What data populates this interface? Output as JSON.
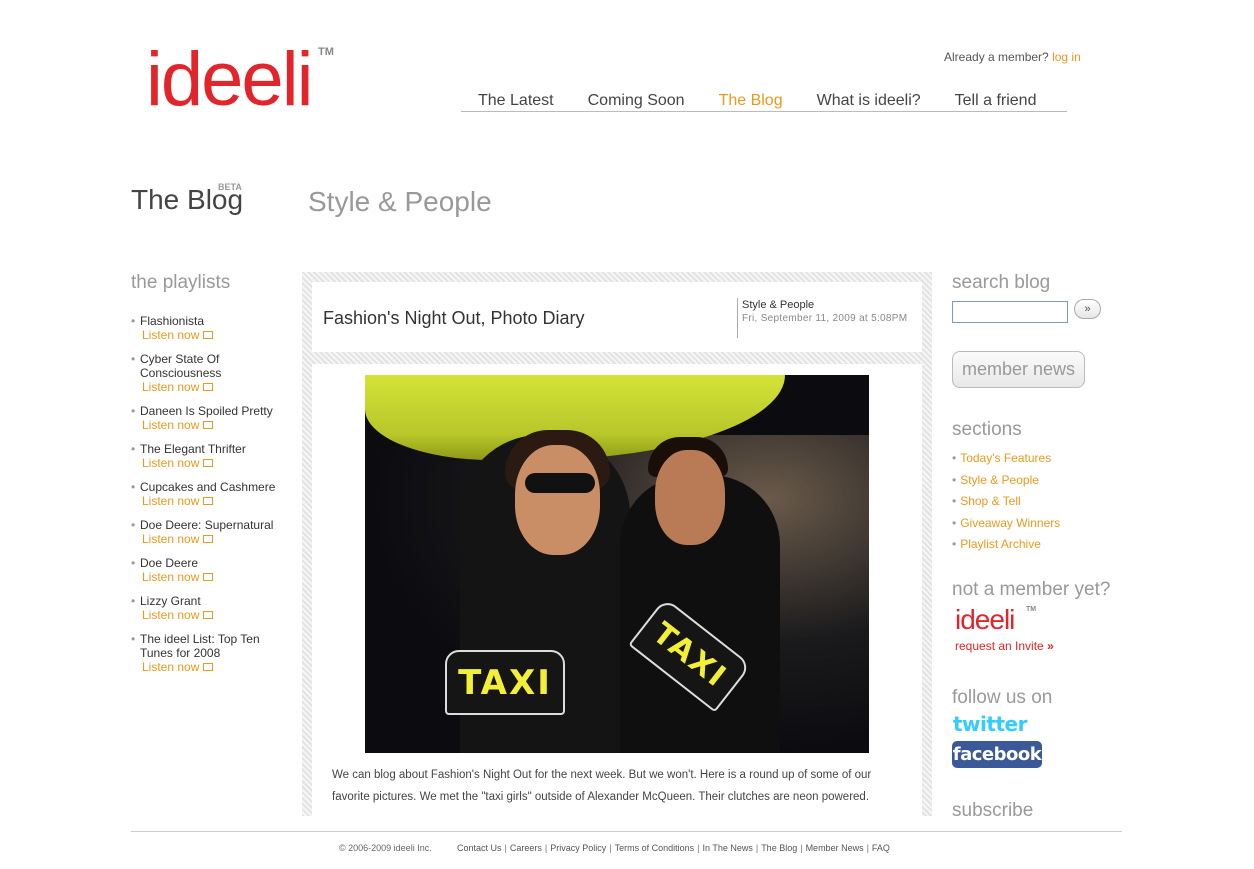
{
  "header": {
    "logo": "ideeli",
    "logo_tm": "TM",
    "member_text": "Already a member?",
    "login_label": "log in",
    "nav": [
      "The Latest",
      "Coming Soon",
      "The Blog",
      "What is ideeli?",
      "Tell a friend"
    ],
    "nav_active_index": 2
  },
  "blog": {
    "title": "The Blog",
    "beta": "BETA",
    "section": "Style & People"
  },
  "playlists": {
    "heading": "the playlists",
    "listen_label": "Listen now",
    "items": [
      "Flashionista",
      "Cyber State Of Consciousness",
      "Daneen Is Spoiled Pretty",
      "The Elegant Thrifter",
      "Cupcakes and Cashmere",
      "Doe Deere: Supernatural",
      "Doe Deere",
      "Lizzy Grant",
      "The ideel List: Top Ten Tunes for 2008"
    ]
  },
  "post": {
    "title": "Fashion's Night Out, Photo Diary",
    "category": "Style & People",
    "date": "Fri, September 11, 2009 at 5:08PM",
    "taxi_text": "TAXI",
    "body": "We can blog about Fashion's Night Out for the next week. But we won't. Here is a round up of some of our favorite pictures. We met the \"taxi girls\" outside of Alexander McQueen. Their clutches are neon powered."
  },
  "sidebar": {
    "search_heading": "search blog",
    "search_value": "",
    "search_button": "»",
    "member_news": "member news",
    "sections_heading": "sections",
    "sections": [
      "Today's Features",
      "Style & People",
      "Shop & Tell",
      "Giveaway Winners",
      "Playlist Archive"
    ],
    "not_member_heading": "not a member yet?",
    "mini_logo": "ideeli",
    "mini_tm": "TM",
    "request_invite": "request an Invite",
    "request_arrow": "»",
    "follow_heading": "follow us on",
    "twitter": "twitter",
    "facebook": "facebook",
    "subscribe_heading": "subscribe"
  },
  "footer": {
    "copyright": "© 2006-2009 ideeli Inc.",
    "links": [
      "Contact Us",
      "Careers",
      "Privacy Policy",
      "Terms of Conditions",
      "In The News",
      "The Blog",
      "Member News",
      "FAQ"
    ]
  },
  "colors": {
    "brand_red": "#e2242b",
    "accent_orange": "#e89a1c",
    "heading_gray": "#999999",
    "facebook_blue": "#3b5998",
    "twitter_blue": "#33ccff"
  }
}
